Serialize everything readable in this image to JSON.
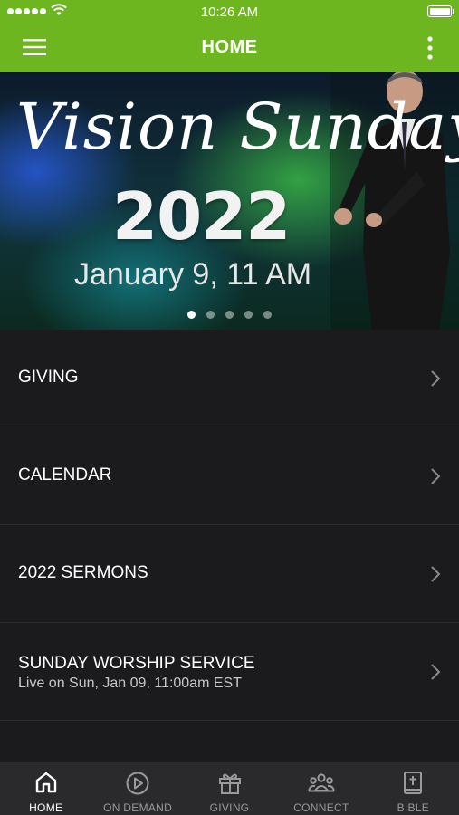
{
  "status_bar": {
    "time": "10:26 AM"
  },
  "header": {
    "title": "HOME"
  },
  "hero": {
    "title_script": "Vision Sunday",
    "year": "2022",
    "date": "January 9, 11 AM",
    "slide_count": 5,
    "active_slide": 1
  },
  "menu_items": [
    {
      "label": "GIVING"
    },
    {
      "label": "CALENDAR"
    },
    {
      "label": "2022 SERMONS"
    },
    {
      "label": "SUNDAY WORSHIP SERVICE",
      "subtitle": "Live on Sun, Jan 09, 11:00am EST"
    }
  ],
  "tabs": [
    {
      "label": "HOME",
      "icon": "home-icon",
      "active": true
    },
    {
      "label": "ON DEMAND",
      "icon": "play-circle-icon",
      "active": false
    },
    {
      "label": "GIVING",
      "icon": "gift-icon",
      "active": false
    },
    {
      "label": "CONNECT",
      "icon": "people-icon",
      "active": false
    },
    {
      "label": "BIBLE",
      "icon": "bible-icon",
      "active": false
    }
  ],
  "colors": {
    "accent": "#6db61f",
    "background": "#1b1b1d",
    "tab_bar": "#2a2a2c"
  }
}
